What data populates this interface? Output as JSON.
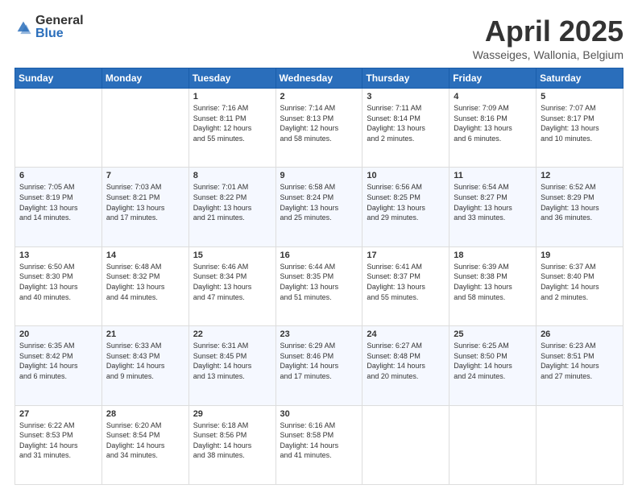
{
  "header": {
    "logo_general": "General",
    "logo_blue": "Blue",
    "title": "April 2025",
    "subtitle": "Wasseiges, Wallonia, Belgium"
  },
  "weekdays": [
    "Sunday",
    "Monday",
    "Tuesday",
    "Wednesday",
    "Thursday",
    "Friday",
    "Saturday"
  ],
  "weeks": [
    [
      {
        "day": "",
        "info": ""
      },
      {
        "day": "",
        "info": ""
      },
      {
        "day": "1",
        "info": "Sunrise: 7:16 AM\nSunset: 8:11 PM\nDaylight: 12 hours\nand 55 minutes."
      },
      {
        "day": "2",
        "info": "Sunrise: 7:14 AM\nSunset: 8:13 PM\nDaylight: 12 hours\nand 58 minutes."
      },
      {
        "day": "3",
        "info": "Sunrise: 7:11 AM\nSunset: 8:14 PM\nDaylight: 13 hours\nand 2 minutes."
      },
      {
        "day": "4",
        "info": "Sunrise: 7:09 AM\nSunset: 8:16 PM\nDaylight: 13 hours\nand 6 minutes."
      },
      {
        "day": "5",
        "info": "Sunrise: 7:07 AM\nSunset: 8:17 PM\nDaylight: 13 hours\nand 10 minutes."
      }
    ],
    [
      {
        "day": "6",
        "info": "Sunrise: 7:05 AM\nSunset: 8:19 PM\nDaylight: 13 hours\nand 14 minutes."
      },
      {
        "day": "7",
        "info": "Sunrise: 7:03 AM\nSunset: 8:21 PM\nDaylight: 13 hours\nand 17 minutes."
      },
      {
        "day": "8",
        "info": "Sunrise: 7:01 AM\nSunset: 8:22 PM\nDaylight: 13 hours\nand 21 minutes."
      },
      {
        "day": "9",
        "info": "Sunrise: 6:58 AM\nSunset: 8:24 PM\nDaylight: 13 hours\nand 25 minutes."
      },
      {
        "day": "10",
        "info": "Sunrise: 6:56 AM\nSunset: 8:25 PM\nDaylight: 13 hours\nand 29 minutes."
      },
      {
        "day": "11",
        "info": "Sunrise: 6:54 AM\nSunset: 8:27 PM\nDaylight: 13 hours\nand 33 minutes."
      },
      {
        "day": "12",
        "info": "Sunrise: 6:52 AM\nSunset: 8:29 PM\nDaylight: 13 hours\nand 36 minutes."
      }
    ],
    [
      {
        "day": "13",
        "info": "Sunrise: 6:50 AM\nSunset: 8:30 PM\nDaylight: 13 hours\nand 40 minutes."
      },
      {
        "day": "14",
        "info": "Sunrise: 6:48 AM\nSunset: 8:32 PM\nDaylight: 13 hours\nand 44 minutes."
      },
      {
        "day": "15",
        "info": "Sunrise: 6:46 AM\nSunset: 8:34 PM\nDaylight: 13 hours\nand 47 minutes."
      },
      {
        "day": "16",
        "info": "Sunrise: 6:44 AM\nSunset: 8:35 PM\nDaylight: 13 hours\nand 51 minutes."
      },
      {
        "day": "17",
        "info": "Sunrise: 6:41 AM\nSunset: 8:37 PM\nDaylight: 13 hours\nand 55 minutes."
      },
      {
        "day": "18",
        "info": "Sunrise: 6:39 AM\nSunset: 8:38 PM\nDaylight: 13 hours\nand 58 minutes."
      },
      {
        "day": "19",
        "info": "Sunrise: 6:37 AM\nSunset: 8:40 PM\nDaylight: 14 hours\nand 2 minutes."
      }
    ],
    [
      {
        "day": "20",
        "info": "Sunrise: 6:35 AM\nSunset: 8:42 PM\nDaylight: 14 hours\nand 6 minutes."
      },
      {
        "day": "21",
        "info": "Sunrise: 6:33 AM\nSunset: 8:43 PM\nDaylight: 14 hours\nand 9 minutes."
      },
      {
        "day": "22",
        "info": "Sunrise: 6:31 AM\nSunset: 8:45 PM\nDaylight: 14 hours\nand 13 minutes."
      },
      {
        "day": "23",
        "info": "Sunrise: 6:29 AM\nSunset: 8:46 PM\nDaylight: 14 hours\nand 17 minutes."
      },
      {
        "day": "24",
        "info": "Sunrise: 6:27 AM\nSunset: 8:48 PM\nDaylight: 14 hours\nand 20 minutes."
      },
      {
        "day": "25",
        "info": "Sunrise: 6:25 AM\nSunset: 8:50 PM\nDaylight: 14 hours\nand 24 minutes."
      },
      {
        "day": "26",
        "info": "Sunrise: 6:23 AM\nSunset: 8:51 PM\nDaylight: 14 hours\nand 27 minutes."
      }
    ],
    [
      {
        "day": "27",
        "info": "Sunrise: 6:22 AM\nSunset: 8:53 PM\nDaylight: 14 hours\nand 31 minutes."
      },
      {
        "day": "28",
        "info": "Sunrise: 6:20 AM\nSunset: 8:54 PM\nDaylight: 14 hours\nand 34 minutes."
      },
      {
        "day": "29",
        "info": "Sunrise: 6:18 AM\nSunset: 8:56 PM\nDaylight: 14 hours\nand 38 minutes."
      },
      {
        "day": "30",
        "info": "Sunrise: 6:16 AM\nSunset: 8:58 PM\nDaylight: 14 hours\nand 41 minutes."
      },
      {
        "day": "",
        "info": ""
      },
      {
        "day": "",
        "info": ""
      },
      {
        "day": "",
        "info": ""
      }
    ]
  ]
}
